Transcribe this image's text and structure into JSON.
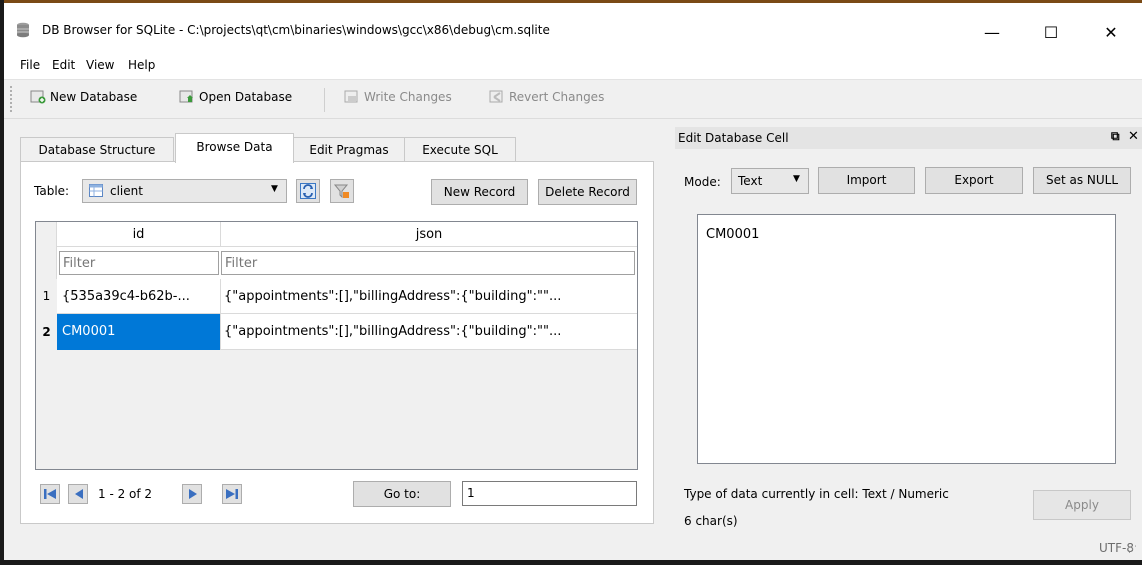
{
  "window": {
    "title": "DB Browser for SQLite - C:\\projects\\qt\\cm\\binaries\\windows\\gcc\\x86\\debug\\cm.sqlite",
    "minimize": "—",
    "maximize": "☐",
    "close": "✕"
  },
  "menu": [
    "File",
    "Edit",
    "View",
    "Help"
  ],
  "toolbar": {
    "new_database": "New Database",
    "open_database": "Open Database",
    "write_changes": "Write Changes",
    "revert_changes": "Revert Changes"
  },
  "tabs": [
    "Database Structure",
    "Browse Data",
    "Edit Pragmas",
    "Execute SQL"
  ],
  "browse": {
    "table_label": "Table:",
    "table_value": "client",
    "new_record": "New Record",
    "delete_record": "Delete Record",
    "columns": [
      "id",
      "json"
    ],
    "filter_placeholder": "Filter",
    "rows": [
      {
        "num": "1",
        "id": "{535a39c4-b62b-...",
        "json": "{\"appointments\":[],\"billingAddress\":{\"building\":\"\"..."
      },
      {
        "num": "2",
        "id": "CM0001",
        "json": "{\"appointments\":[],\"billingAddress\":{\"building\":\"\"..."
      }
    ],
    "pager_text": "1 - 2 of 2",
    "goto_label": "Go to:",
    "goto_value": "1"
  },
  "edit_cell": {
    "title": "Edit Database Cell",
    "mode_label": "Mode:",
    "mode_value": "Text",
    "import": "Import",
    "export": "Export",
    "set_null": "Set as NULL",
    "content": "CM0001",
    "type_info": "Type of data currently in cell: Text / Numeric",
    "size_info": "6 char(s)",
    "apply": "Apply",
    "encoding": "UTF-8"
  },
  "colors": {
    "selection": "#0078d7",
    "frame_top": "#7a4a16"
  }
}
